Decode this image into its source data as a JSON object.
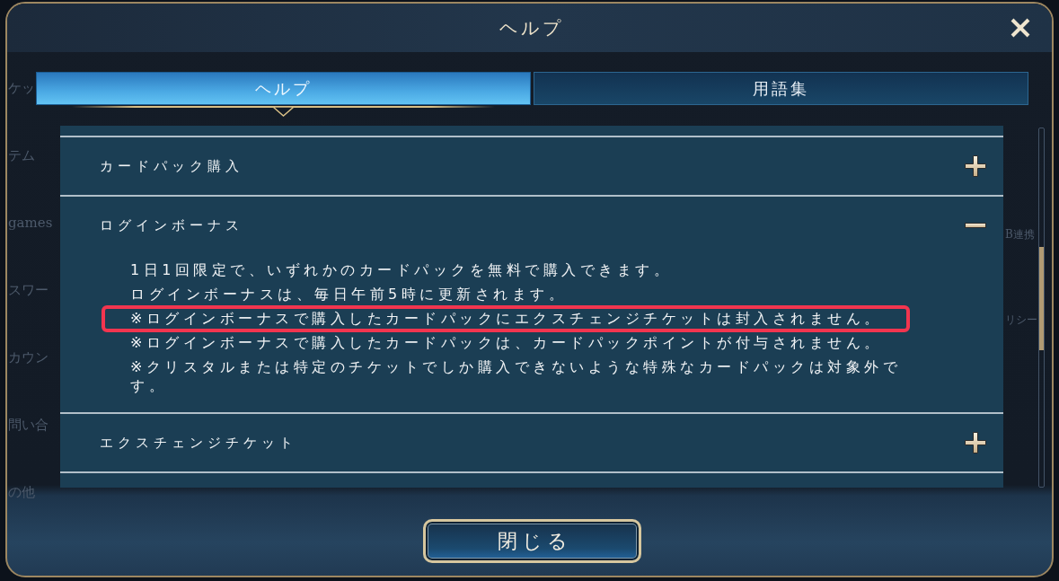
{
  "dialog": {
    "title": "ヘルプ"
  },
  "tabs": [
    {
      "label": "ヘルプ",
      "selected": true
    },
    {
      "label": "用語集",
      "selected": false
    }
  ],
  "sections": [
    {
      "title": "カードパック購入",
      "expanded": false
    },
    {
      "title": "ログインボーナス",
      "expanded": true,
      "body": [
        {
          "text": "1日1回限定で、いずれかのカードパックを無料で購入できます。",
          "highlighted": false
        },
        {
          "text": "ログインボーナスは、毎日午前5時に更新されます。",
          "highlighted": false
        },
        {
          "text": "※ログインボーナスで購入したカードパックにエクスチェンジチケットは封入されません。",
          "highlighted": true
        },
        {
          "text": "※ログインボーナスで購入したカードパックは、カードパックポイントが付与されません。",
          "highlighted": false
        },
        {
          "text": "※クリスタルまたは特定のチケットでしか購入できないような特殊なカードパックは対象外です。",
          "highlighted": false
        }
      ]
    },
    {
      "title": "エクスチェンジチケット",
      "expanded": false
    }
  ],
  "footer_button": {
    "label": "閉じる"
  },
  "background_menu": {
    "left_items": [
      "ケッ",
      "テム",
      "games",
      "スワー",
      "カウン",
      "問い合",
      "の他"
    ],
    "right_items": [
      "B連携",
      "リシー"
    ]
  }
}
